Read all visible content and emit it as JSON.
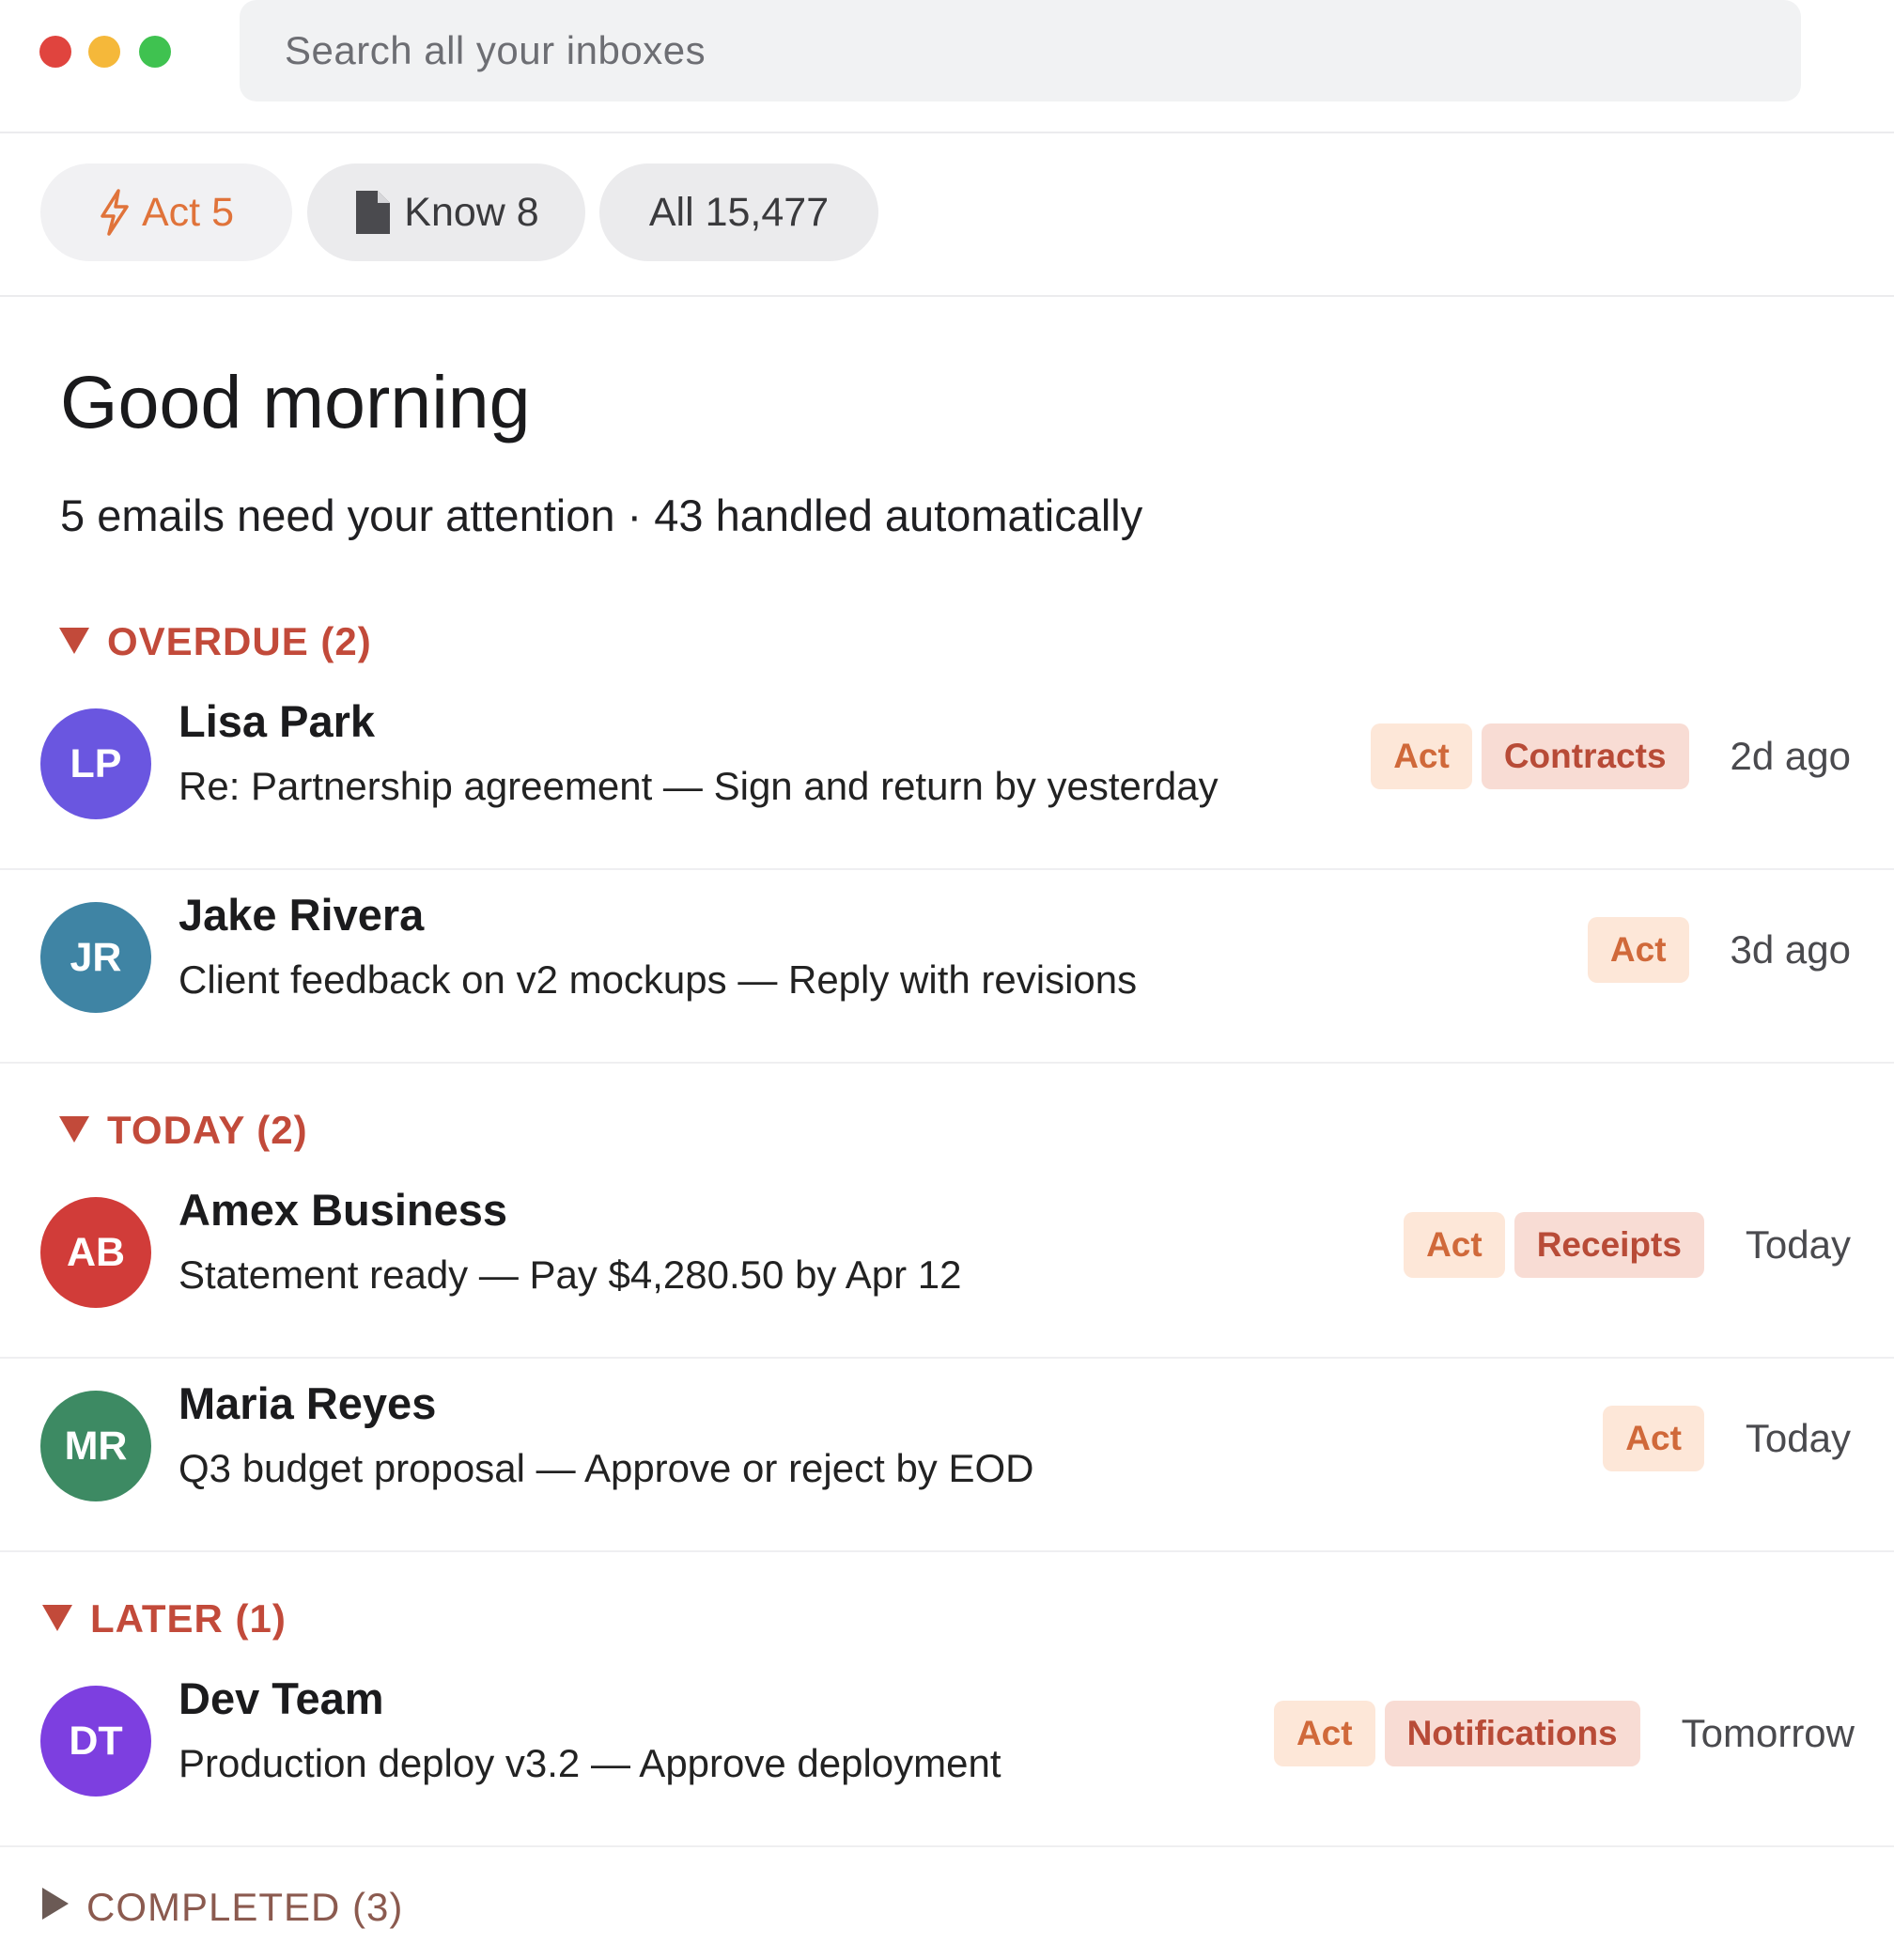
{
  "search": {
    "placeholder": "Search all your inboxes"
  },
  "tabs": [
    {
      "label": "Act 5",
      "icon": "lightning-icon"
    },
    {
      "label": "Know 8",
      "icon": "document-icon"
    },
    {
      "label": "All 15,477"
    }
  ],
  "greeting": "Good morning",
  "summary": "5 emails need your attention · 43 handled automatically",
  "sections": {
    "overdue": "OVERDUE (2)",
    "today": "TODAY (2)",
    "later": "LATER (1)",
    "completed": "COMPLETED (3)"
  },
  "emails": [
    {
      "initials": "LP",
      "sender": "Lisa Park",
      "subject": "Re: Partnership agreement — Sign and return by yesterday",
      "tag": "Act",
      "category": "Contracts",
      "time": "2d ago",
      "avatar_color": "#6a56e0"
    },
    {
      "initials": "JR",
      "sender": "Jake Rivera",
      "subject": "Client feedback on v2 mockups — Reply with revisions",
      "tag": "Act",
      "category": "",
      "time": "3d ago",
      "avatar_color": "#3f84a4"
    },
    {
      "initials": "AB",
      "sender": "Amex Business",
      "subject": "Statement ready — Pay $4,280.50 by Apr 12",
      "tag": "Act",
      "category": "Receipts",
      "time": "Today",
      "avatar_color": "#d13c39"
    },
    {
      "initials": "MR",
      "sender": "Maria Reyes",
      "subject": "Q3 budget proposal — Approve or reject by EOD",
      "tag": "Act",
      "category": "",
      "time": "Today",
      "avatar_color": "#3d8a63"
    },
    {
      "initials": "DT",
      "sender": "Dev Team",
      "subject": "Production deploy v3.2 — Approve deployment",
      "tag": "Act",
      "category": "Notifications",
      "time": "Tomorrow",
      "avatar_color": "#7d3fe0"
    }
  ],
  "colors": {
    "accent_act": "#e0733a",
    "section_header": "#c24a3a",
    "act_pill_bg": "#fde7d8",
    "category_pill_bg": "#f8dcd4"
  }
}
